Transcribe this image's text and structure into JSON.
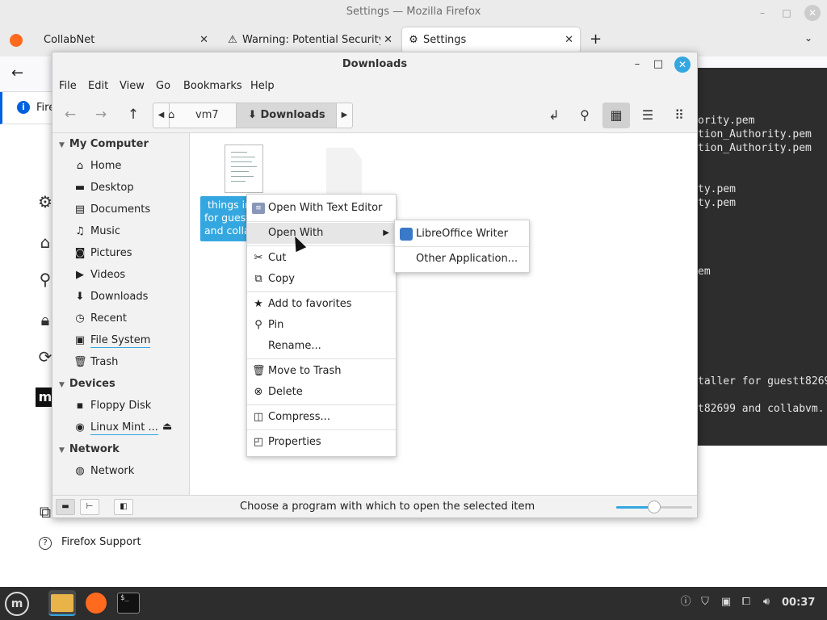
{
  "firefox": {
    "window_title": "Settings — Mozilla Firefox",
    "tabs": [
      {
        "label": "CollabNet"
      },
      {
        "label": "Warning: Potential Security"
      },
      {
        "label": "Settings"
      }
    ],
    "notification_text": "Fire",
    "support_link": "Firefox Support"
  },
  "terminal": {
    "lines": [
      "ority.pem",
      "tion_Authority.pem",
      "tion_Authority.pem",
      "ty.pem",
      "ty.pem",
      "em",
      "taller for guestt8269",
      "t82699 and collabvm."
    ]
  },
  "nemo": {
    "title": "Downloads",
    "menu": [
      "File",
      "Edit",
      "View",
      "Go",
      "Bookmarks",
      "Help"
    ],
    "breadcrumb": {
      "home": "vm7",
      "current": "Downloads"
    },
    "sidebar": {
      "my_computer": "My Computer",
      "my_computer_items": [
        "Home",
        "Desktop",
        "Documents",
        "Music",
        "Pictures",
        "Videos",
        "Downloads",
        "Recent",
        "File System",
        "Trash"
      ],
      "devices": "Devices",
      "device_items": [
        "Floppy Disk",
        "Linux Mint ..."
      ],
      "network": "Network",
      "network_items": [
        "Network"
      ]
    },
    "file_label_lines": [
      "things in",
      "for guest",
      "and colla"
    ],
    "status_text": "Choose a program with which to open the selected item",
    "zoom_level": 0.5
  },
  "context_menu": {
    "items": [
      "Open With Text Editor",
      "Open With",
      "Cut",
      "Copy",
      "Add to favorites",
      "Pin",
      "Rename...",
      "Move to Trash",
      "Delete",
      "Compress...",
      "Properties"
    ],
    "submenu": [
      "LibreOffice Writer",
      "Other Application..."
    ]
  },
  "taskbar": {
    "clock": "00:37"
  },
  "colors": {
    "accent": "#35a7e0",
    "taskbar_bg": "#2d2d2d",
    "terminal_bg": "#2d2d2d"
  }
}
